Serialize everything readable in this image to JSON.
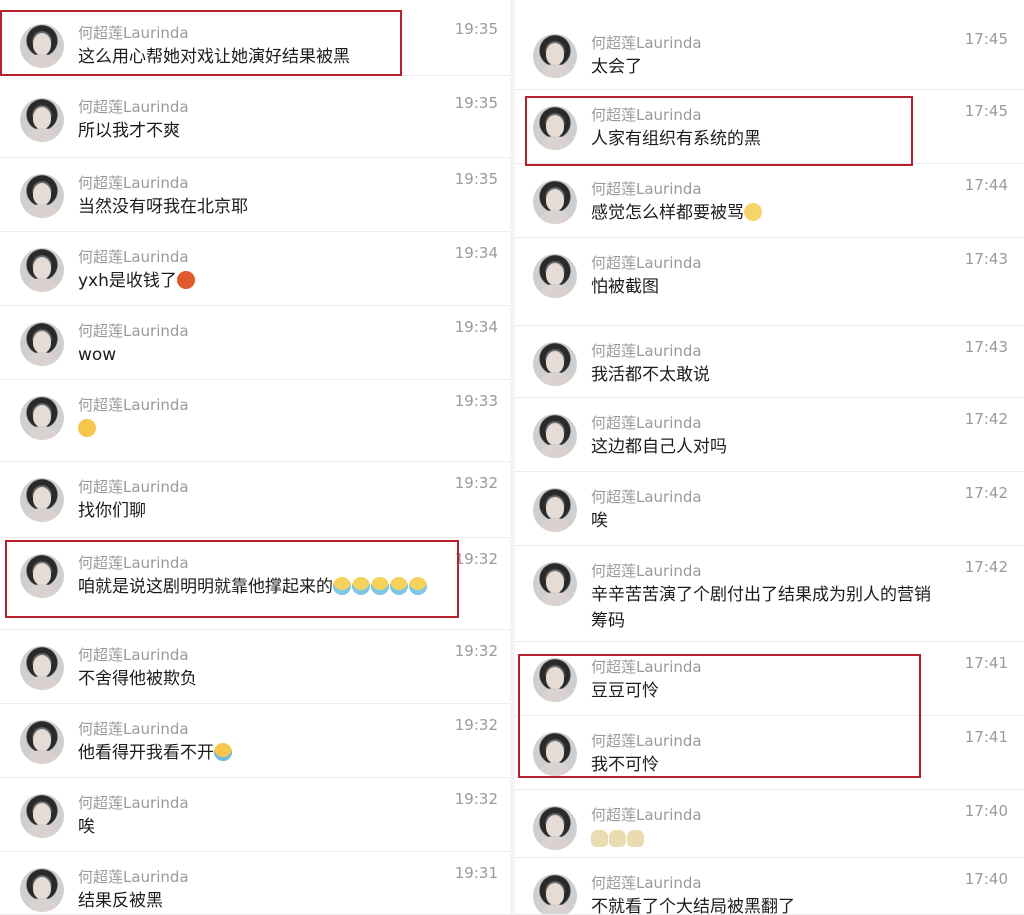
{
  "user_name": "何超莲Laurinda",
  "left_messages": [
    {
      "time": "19:35",
      "text": "这么用心帮她对戏让她演好结果被黑",
      "emojis": []
    },
    {
      "time": "19:35",
      "text": "所以我才不爽",
      "emojis": []
    },
    {
      "time": "19:35",
      "text": "当然没有呀我在北京耶",
      "emojis": []
    },
    {
      "time": "19:34",
      "text": "yxh是收钱了",
      "emojis": [
        "money-bag-emoji"
      ]
    },
    {
      "time": "19:34",
      "text": "wow",
      "emojis": []
    },
    {
      "time": "19:33",
      "text": "",
      "emojis": [
        "sweat-emoji"
      ]
    },
    {
      "time": "19:32",
      "text": "找你们聊",
      "emojis": []
    },
    {
      "time": "19:32",
      "text": "咱就是说这剧明明就靠他撑起来的",
      "emojis": [
        "crying-emoji",
        "crying-emoji",
        "crying-emoji",
        "crying-emoji",
        "crying-emoji"
      ]
    },
    {
      "time": "19:32",
      "text": "不舍得他被欺负",
      "emojis": []
    },
    {
      "time": "19:32",
      "text": "他看得开我看不开",
      "emojis": [
        "laughing-tears-emoji"
      ]
    },
    {
      "time": "19:32",
      "text": "唉",
      "emojis": []
    },
    {
      "time": "19:31",
      "text": "结果反被黑",
      "emojis": []
    }
  ],
  "right_messages": [
    {
      "time": "17:45",
      "text": "太会了",
      "emojis": []
    },
    {
      "time": "17:45",
      "text": "人家有组织有系统的黑",
      "emojis": []
    },
    {
      "time": "17:44",
      "text": "感觉怎么样都要被骂",
      "emojis": [
        "eye-roll-emoji"
      ]
    },
    {
      "time": "17:43",
      "text": "怕被截图",
      "emojis": []
    },
    {
      "time": "17:43",
      "text": "我活都不太敢说",
      "emojis": []
    },
    {
      "time": "17:42",
      "text": "这边都自己人对吗",
      "emojis": []
    },
    {
      "time": "17:42",
      "text": "唉",
      "emojis": []
    },
    {
      "time": "17:42",
      "text": "辛辛苦苦演了个剧付出了结果成为别人的营销筹码",
      "emojis": []
    },
    {
      "time": "17:41",
      "text": "豆豆可怜",
      "emojis": []
    },
    {
      "time": "17:41",
      "text": "我不可怜",
      "emojis": []
    },
    {
      "time": "17:40",
      "text": "",
      "emojis": [
        "skull-emoji",
        "skull-emoji",
        "skull-emoji"
      ]
    },
    {
      "time": "17:40",
      "text": "不就看了个大结局被黑翻了",
      "emojis": []
    }
  ],
  "highlight_color": "#b3212c"
}
